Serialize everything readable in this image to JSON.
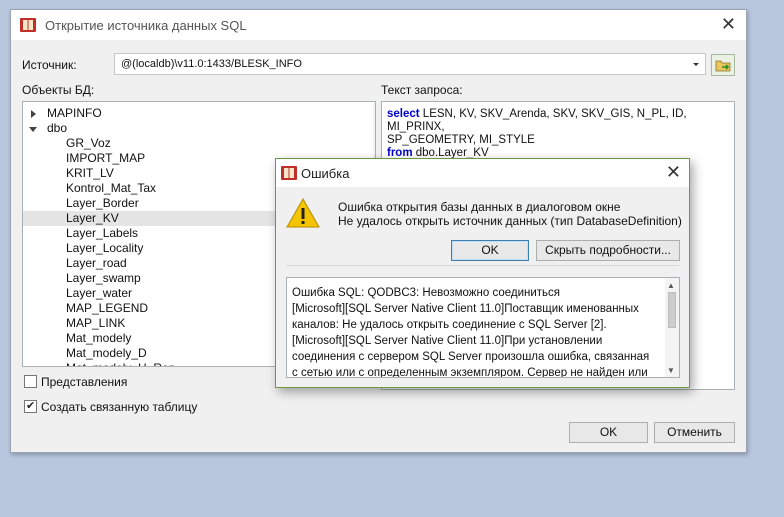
{
  "main_dialog": {
    "title": "Открытие источника данных SQL",
    "source_label": "Источник:",
    "source_value": "@(localdb)\\v11.0:1433/BLESK_INFO",
    "objects_label": "Объекты БД:",
    "query_label": "Текст запроса:",
    "tree": [
      {
        "label": "MAPINFO",
        "level": 0,
        "expander": "collapsed"
      },
      {
        "label": "dbo",
        "level": 0,
        "expander": "expanded"
      },
      {
        "label": "GR_Voz",
        "level": 1
      },
      {
        "label": "IMPORT_MAP",
        "level": 1
      },
      {
        "label": "KRIT_LV",
        "level": 1
      },
      {
        "label": "Kontrol_Mat_Tax",
        "level": 1
      },
      {
        "label": "Layer_Border",
        "level": 1
      },
      {
        "label": "Layer_KV",
        "level": 1,
        "selected": true
      },
      {
        "label": "Layer_Labels",
        "level": 1
      },
      {
        "label": "Layer_Locality",
        "level": 1
      },
      {
        "label": "Layer_road",
        "level": 1
      },
      {
        "label": "Layer_swamp",
        "level": 1
      },
      {
        "label": "Layer_water",
        "level": 1
      },
      {
        "label": "MAP_LEGEND",
        "level": 1
      },
      {
        "label": "MAP_LINK",
        "level": 1
      },
      {
        "label": "Mat_modely",
        "level": 1
      },
      {
        "label": "Mat_modely_D",
        "level": 1
      },
      {
        "label": "Mat_modely_H_Rep",
        "level": 1
      }
    ],
    "query": {
      "select_kw": "select",
      "line1_rest": " LESN, KV, SKV_Arenda, SKV, SKV_GIS, N_PL, ID, MI_PRINX,",
      "line2": "SP_GEOMETRY, MI_STYLE",
      "from_kw": "from",
      "line3_rest": " dbo.Layer_KV"
    },
    "views_checkbox": {
      "label": "Представления",
      "checked": false
    },
    "linked_table_checkbox": {
      "label": "Создать связанную таблицу",
      "checked": true
    },
    "ok_label": "OK",
    "cancel_label": "Отменить"
  },
  "error_dialog": {
    "title": "Ошибка",
    "message_line1": "Ошибка открытия базы данных в диалоговом окне",
    "message_line2": "Не удалось открыть источник данных (тип DatabaseDefinition)",
    "ok_label": "OK",
    "details_button_label": "Скрыть подробности...",
    "details_lines": [
      "Ошибка SQL: QODBC3: Невозможно соединиться",
      "[Microsoft][SQL Server Native Client 11.0]Поставщик именованных",
      "каналов: Не удалось открыть соединение с SQL Server [2].",
      "[Microsoft][SQL Server Native Client 11.0]При установлении",
      "соединения с сервером SQL Server произошла ошибка, связанная",
      "с сетью или с определенным экземпляром. Сервер не найден или"
    ]
  },
  "icons": {
    "app": "red-book-icon",
    "warning": "warning-triangle-icon",
    "browse": "open-folder-arrow-icon",
    "close": "close-icon"
  },
  "colors": {
    "keyword": "#0000cc",
    "desktop": "#b8c6de",
    "warning": "#f5c400"
  }
}
